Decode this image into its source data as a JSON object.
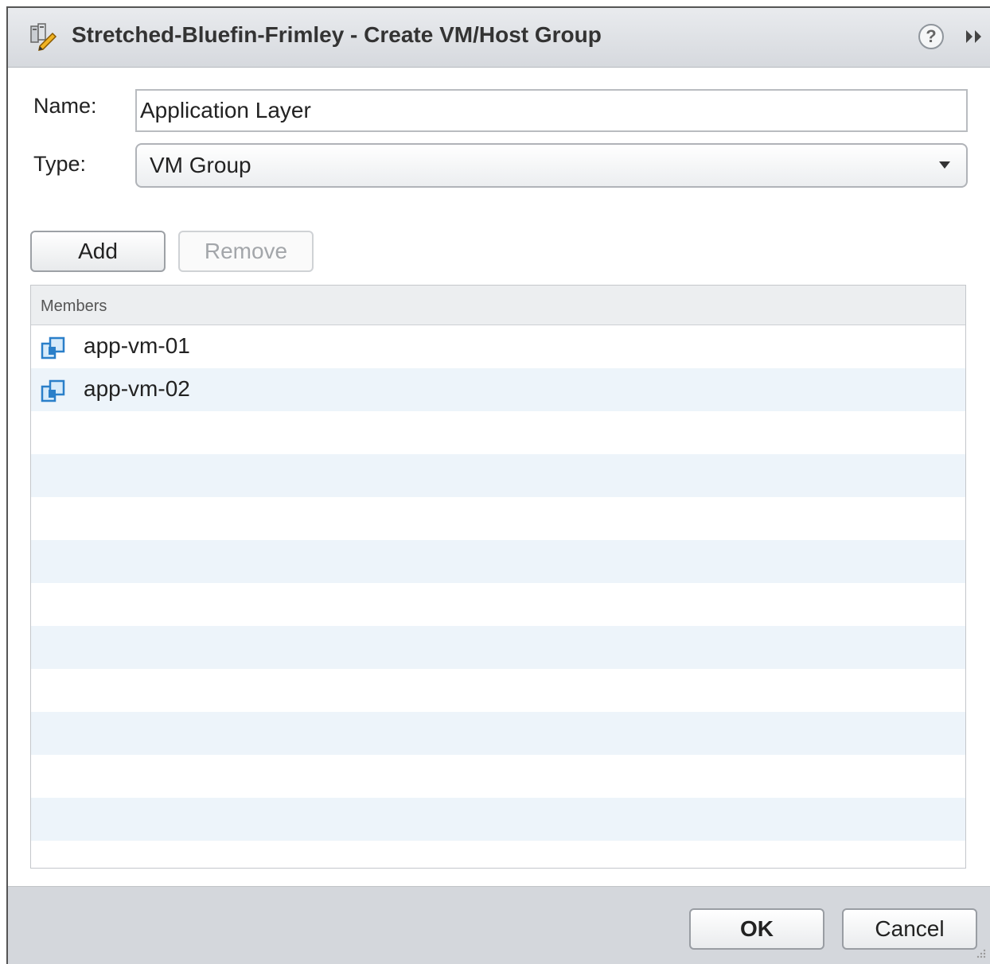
{
  "dialog": {
    "title": "Stretched-Bluefin-Frimley - Create VM/Host Group",
    "help_label": "?"
  },
  "form": {
    "name_label": "Name:",
    "name_value": "Application Layer",
    "type_label": "Type:",
    "type_value": "VM Group"
  },
  "toolbar": {
    "add_label": "Add",
    "remove_label": "Remove"
  },
  "members": {
    "header": "Members",
    "items": [
      {
        "name": "app-vm-01",
        "icon": "vm-icon"
      },
      {
        "name": "app-vm-02",
        "icon": "vm-icon"
      }
    ]
  },
  "footer": {
    "ok_label": "OK",
    "cancel_label": "Cancel"
  },
  "colors": {
    "row_alt": "#edf4fa",
    "vm_icon": "#2a7fc9",
    "footer_bg": "#d4d7dc"
  }
}
